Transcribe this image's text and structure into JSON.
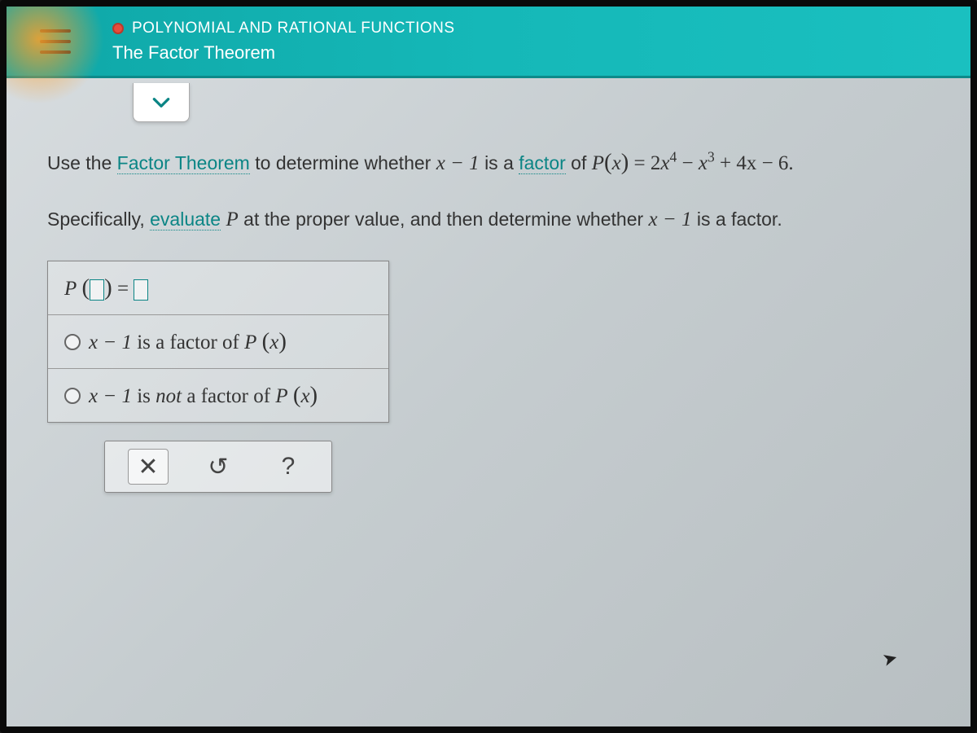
{
  "header": {
    "category": "POLYNOMIAL AND RATIONAL FUNCTIONS",
    "lesson": "The Factor Theorem"
  },
  "question": {
    "prefix": "Use the ",
    "link1": "Factor Theorem",
    "mid1": " to determine whether ",
    "expr_linear": "x − 1",
    "mid2": " is a ",
    "link2": "factor",
    "mid3": " of ",
    "poly_label": "P",
    "poly_var": "x",
    "poly_rhs_pre": " = 2",
    "poly_rhs_rest": "+ 4x − 6.",
    "line2a": "Specifically, ",
    "link3": "evaluate",
    "line2b": " P",
    "line2c": " at the proper value, and then determine whether ",
    "line2d": "x − 1",
    "line2e": " is a factor."
  },
  "answer": {
    "func_label": "P",
    "equals": " = ",
    "opt1_pre": "x − 1",
    "opt1_mid": " is a factor of ",
    "opt1_func": "P",
    "opt1_var": "x",
    "opt2_pre": "x − 1",
    "opt2_mid_a": " is ",
    "opt2_mid_not": "not",
    "opt2_mid_b": " a factor of ",
    "opt2_func": "P",
    "opt2_var": "x"
  },
  "actions": {
    "clear": "✕",
    "reset": "↺",
    "help": "?"
  }
}
